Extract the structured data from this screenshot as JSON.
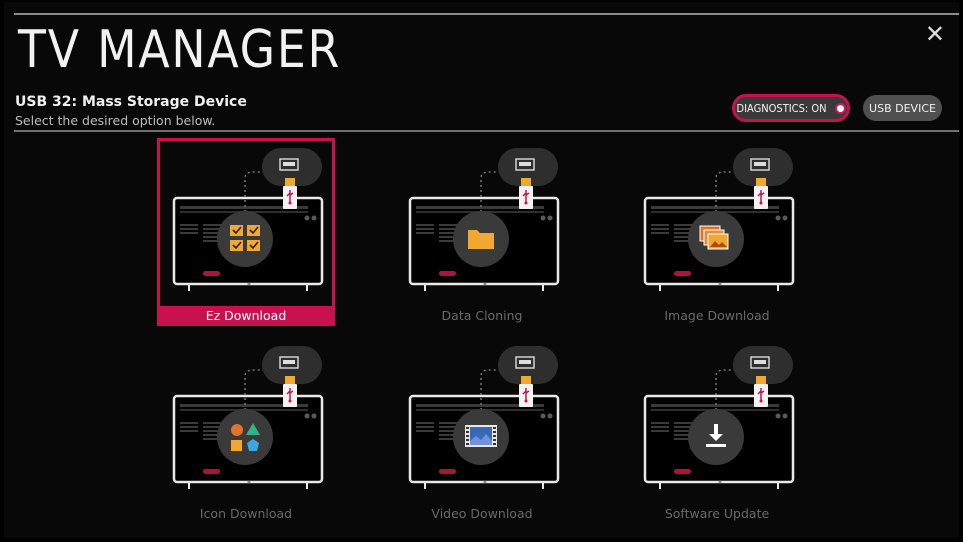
{
  "header": {
    "title": "TV MANAGER",
    "device_name": "USB 32: Mass Storage Device",
    "device_subtitle": "Select the desired option below.",
    "close_glyph": "✕"
  },
  "buttons": {
    "diagnostics_label": "DIAGNOSTICS: ON",
    "usb_device_label": "USB DEVICE"
  },
  "accent_color": "#c8124f",
  "options": [
    {
      "label": "Ez Download",
      "icon": "checklist-icon",
      "selected": true
    },
    {
      "label": "Data Cloning",
      "icon": "folder-icon",
      "selected": false
    },
    {
      "label": "Image Download",
      "icon": "images-icon",
      "selected": false
    },
    {
      "label": "Icon Download",
      "icon": "shapes-icon",
      "selected": false
    },
    {
      "label": "Video Download",
      "icon": "film-icon",
      "selected": false
    },
    {
      "label": "Software Update",
      "icon": "download-arrow-icon",
      "selected": false
    }
  ]
}
